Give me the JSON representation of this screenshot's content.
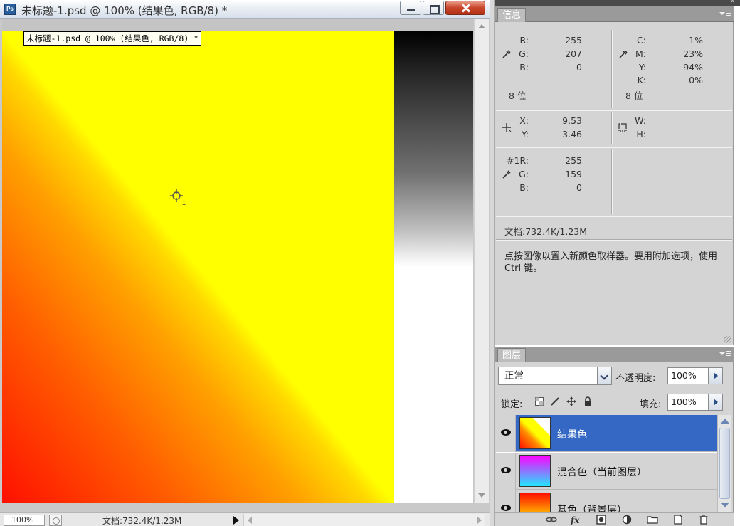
{
  "document": {
    "window_title": "未标题-1.psd @ 100% (结果色, RGB/8) *",
    "app_logo": "Ps",
    "tooltip": "未标题-1.psd @ 100% (结果色, RGB/8) *",
    "sampler_number": "1",
    "status": {
      "zoom": "100%",
      "doc_size": "文档:732.4K/1.23M"
    }
  },
  "info_panel": {
    "tab_label": "信息",
    "rgb": {
      "r_label": "R:",
      "g_label": "G:",
      "b_label": "B:",
      "r": "255",
      "g": "207",
      "b": "0",
      "bits": "8 位"
    },
    "cmyk": {
      "c_label": "C:",
      "m_label": "M:",
      "y_label": "Y:",
      "k_label": "K:",
      "c": "1%",
      "m": "23%",
      "y": "94%",
      "k": "0%",
      "bits": "8 位"
    },
    "position": {
      "x_label": "X:",
      "y_label": "Y:",
      "x": "9.53",
      "y": "3.46"
    },
    "size": {
      "w_label": "W:",
      "h_label": "H:"
    },
    "sampler1": {
      "r_label": "#1R:",
      "g_label": "G:",
      "b_label": "B:",
      "r": "255",
      "g": "159",
      "b": "0"
    },
    "doc_size": "文档:732.4K/1.23M",
    "hint": "点按图像以置入新颜色取样器。要用附加选项，使用 Ctrl 键。"
  },
  "layers_panel": {
    "tab_label": "图层",
    "blend_mode": "正常",
    "opacity_label": "不透明度:",
    "opacity": "100%",
    "lock_label": "锁定:",
    "fill_label": "填充:",
    "fill": "100%",
    "layers": [
      {
        "name": "结果色",
        "selected": true
      },
      {
        "name": "混合色（当前图层）",
        "selected": false
      },
      {
        "name": "基色（背景层）",
        "selected": false
      }
    ]
  },
  "colors": {
    "selection_blue": "#3468c4",
    "panel_gray": "#d4d4d4",
    "close_red": "#c8452a"
  },
  "icons": [
    "eyedropper-icon",
    "crosshair-icon",
    "marquee-size-icon",
    "eye-icon",
    "link-icon",
    "fx-icon",
    "mask-icon",
    "adjustment-icon",
    "folder-icon",
    "new-layer-icon",
    "trash-icon"
  ]
}
